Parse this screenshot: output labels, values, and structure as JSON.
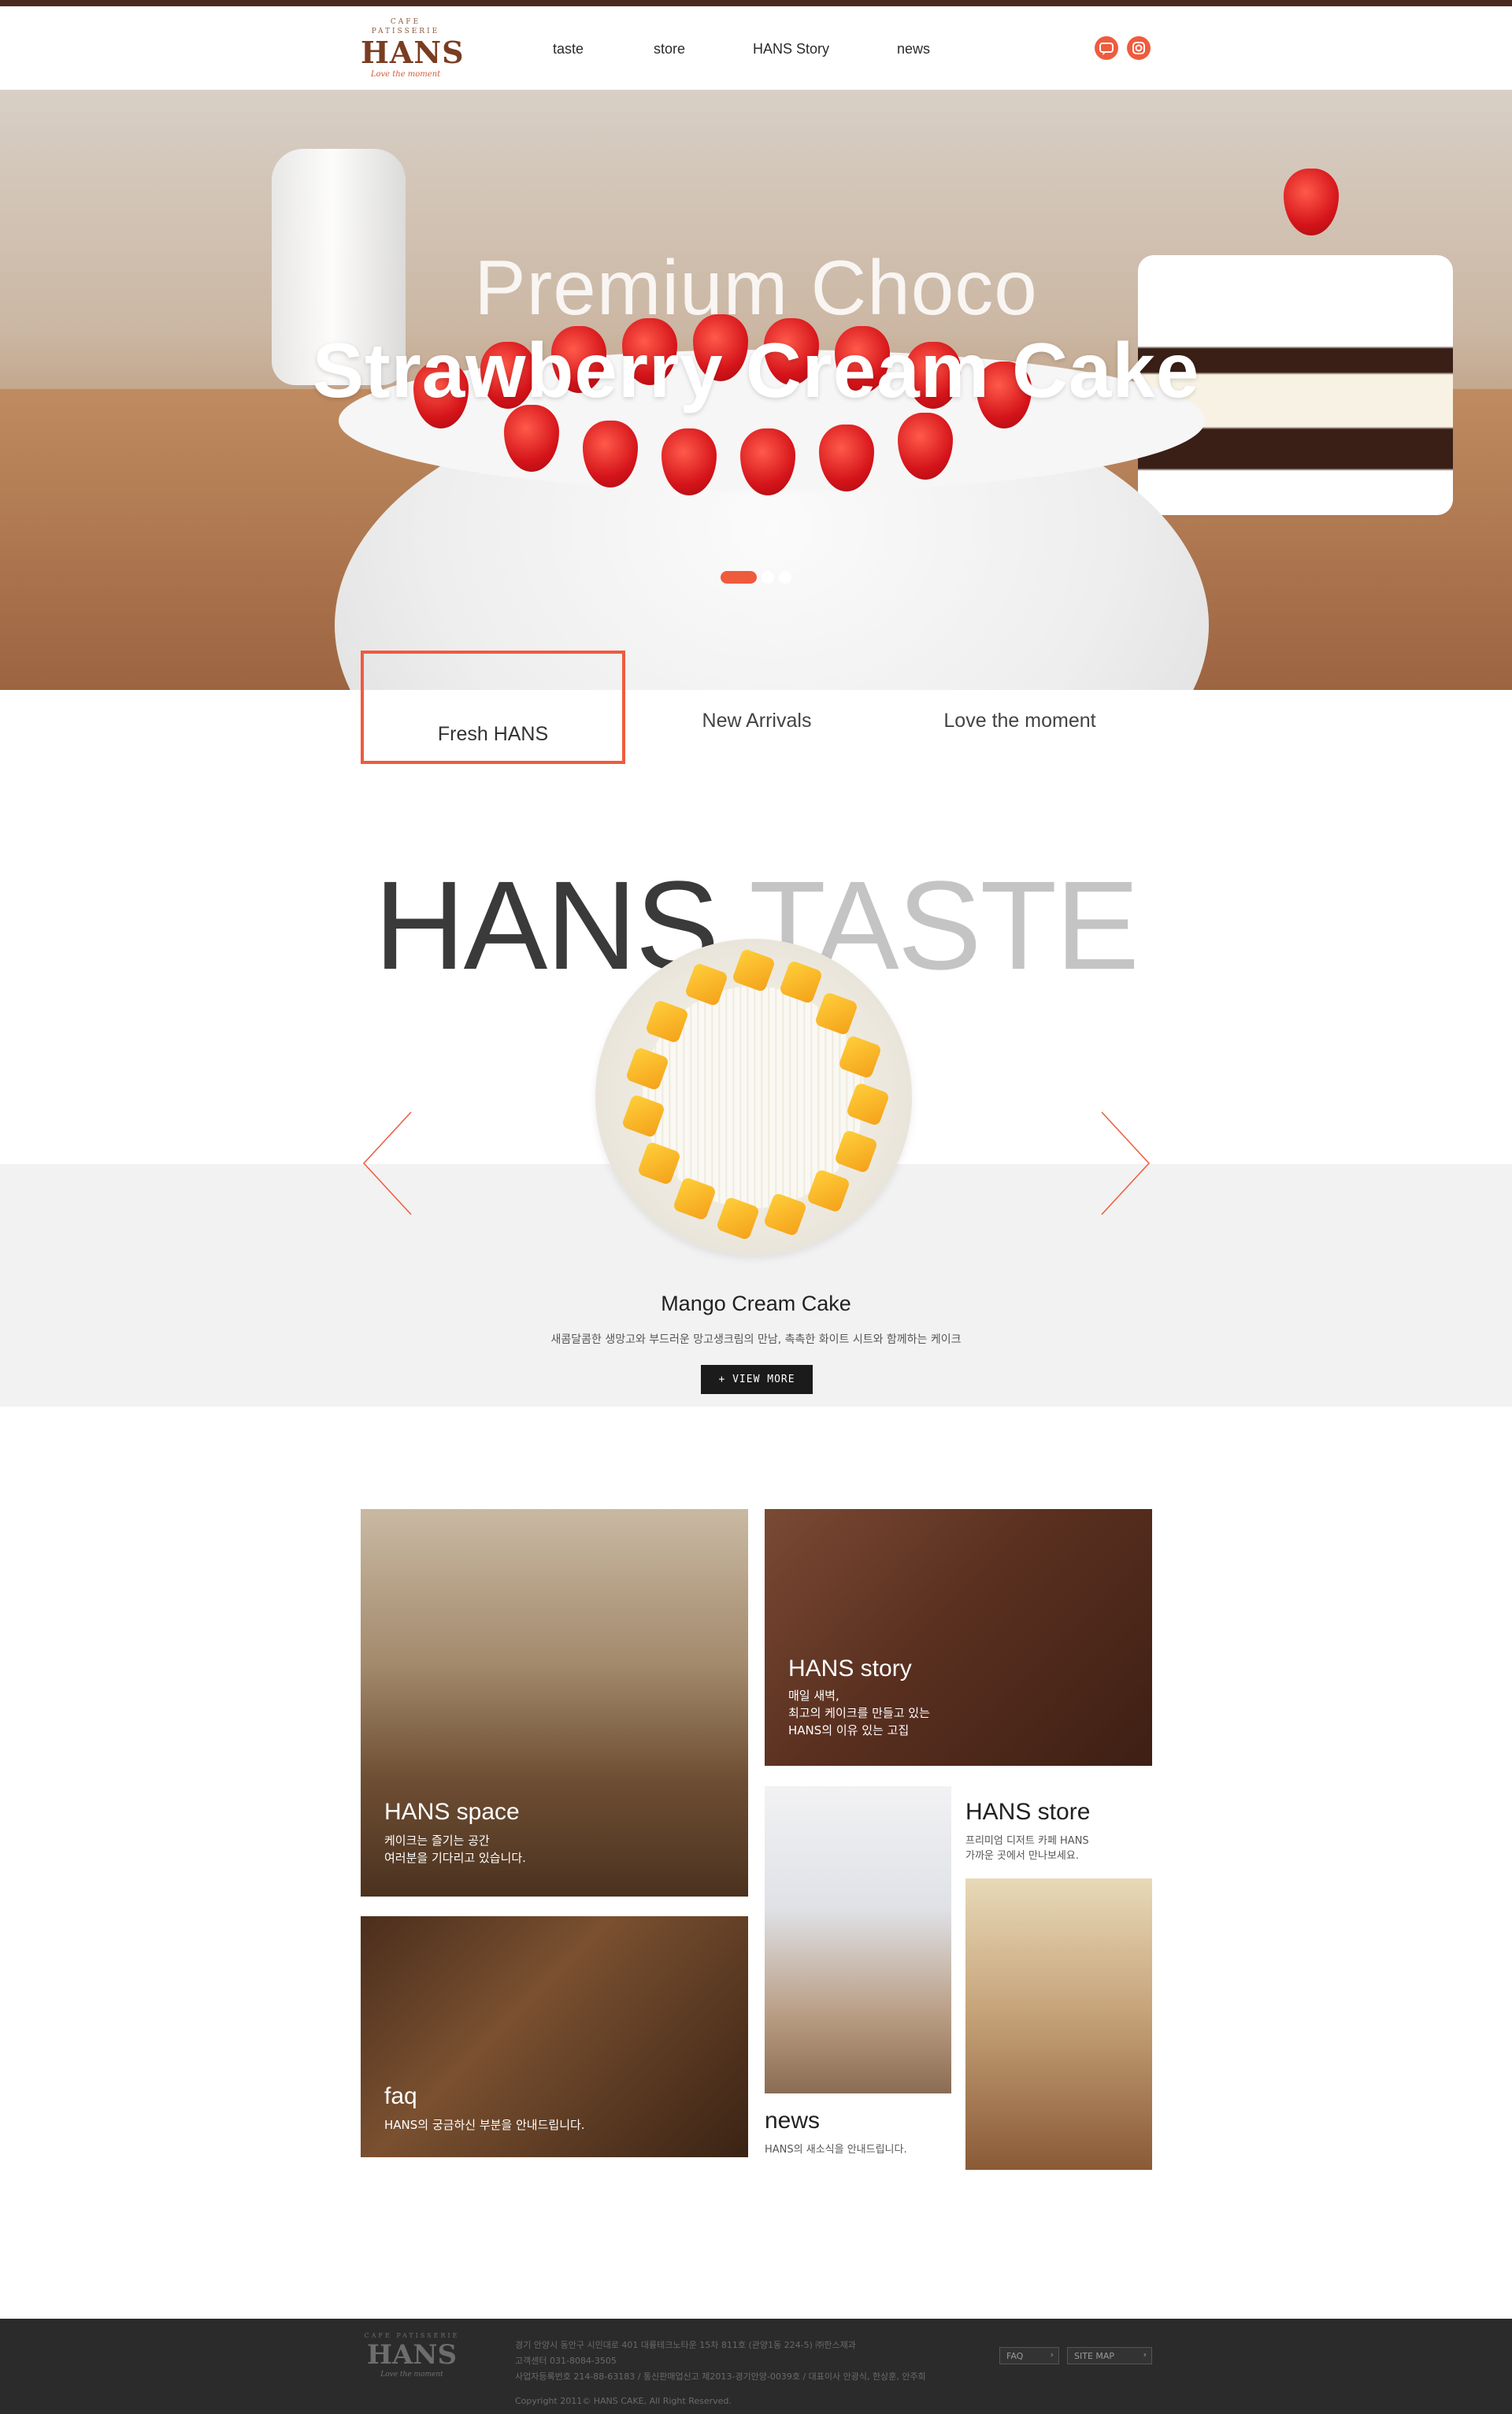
{
  "header": {
    "logo": {
      "top": "CAFE PATISSERIE",
      "brand": "HANS",
      "tagline": "Love the moment"
    },
    "nav": [
      "taste",
      "store",
      "HANS Story",
      "news"
    ],
    "sns": [
      "chat-icon",
      "instagram-icon"
    ]
  },
  "hero": {
    "title_line1": "Premium Choco",
    "title_line2": "Strawberry Cream Cake",
    "slides_total": 3,
    "slide_active": 1
  },
  "tabs": [
    "Fresh HANS",
    "New Arrivals",
    "Love the moment"
  ],
  "taste": {
    "title_part1": "HANS",
    "title_part2": "TASTE",
    "product_name": "Mango Cream Cake",
    "product_desc": "새콤달콤한 생망고와 부드러운 망고생크림의 만남, 촉촉한 화이트 시트와 함께하는 케이크",
    "view_more": "+ VIEW MORE"
  },
  "tiles": {
    "space": {
      "title": "HANS space",
      "text": "케이크는 즐기는 공간\n여러분을 기다리고 있습니다."
    },
    "story": {
      "title": "HANS story",
      "text": "매일 새벽,\n최고의 케이크를 만들고 있는\nHANS의 이유 있는 고집"
    },
    "store": {
      "title": "HANS store",
      "text": "프리미엄 디저트 카페 HANS\n가까운 곳에서 만나보세요."
    },
    "faq": {
      "title": "faq",
      "text": "HANS의 궁금하신 부분을 안내드립니다."
    },
    "news": {
      "title": "news",
      "text": "HANS의 새소식을 안내드립니다."
    }
  },
  "footer": {
    "logo": {
      "top": "CAFE PATISSERIE",
      "brand": "HANS",
      "tagline": "Love the moment"
    },
    "info": "경기 안양시 동안구 시민대로 401 대륭테크노타운 15차 811호 (관양1동 224-5) ㈜한스제과\n고객센터 031-8084-3505\n사업자등록번호 214-88-63183 / 통신판매업신고 제2013-경기안양-0039호 / 대표이사 안광식, 한상훈, 안주희",
    "copyright": "Copyright 2011© HANS CAKE, All Right Reserved.",
    "buttons": [
      "FAQ",
      "SITE MAP"
    ]
  },
  "colors": {
    "accent": "#ef5b3d",
    "brand_brown": "#7a3d22",
    "footer_bg": "#2b2b2b",
    "band_gray": "#f2f2f2"
  }
}
